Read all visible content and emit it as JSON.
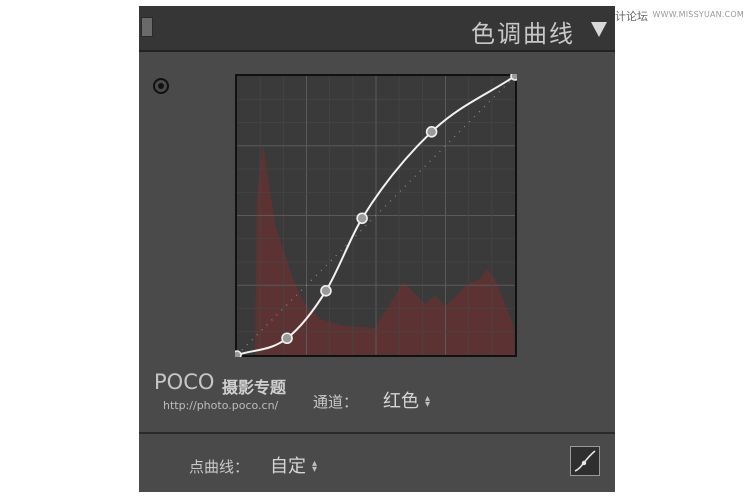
{
  "watermark": {
    "site": "思缘设计论坛",
    "url": "WWW.MISSYUAN.COM"
  },
  "panel": {
    "title": "色调曲线",
    "channel": {
      "label": "通道：",
      "value": "红色"
    },
    "point_curve": {
      "label": "点曲线：",
      "value": "自定"
    }
  },
  "logo": {
    "brand": "POCO",
    "brand_zh": "摄影专题",
    "url": "http://photo.poco.cn/"
  },
  "curve": {
    "channel_color": "#8a2a2a",
    "control_points": [
      [
        0,
        0
      ],
      [
        0.18,
        0.06
      ],
      [
        0.32,
        0.23
      ],
      [
        0.45,
        0.49
      ],
      [
        0.7,
        0.8
      ],
      [
        1,
        1
      ]
    ]
  }
}
